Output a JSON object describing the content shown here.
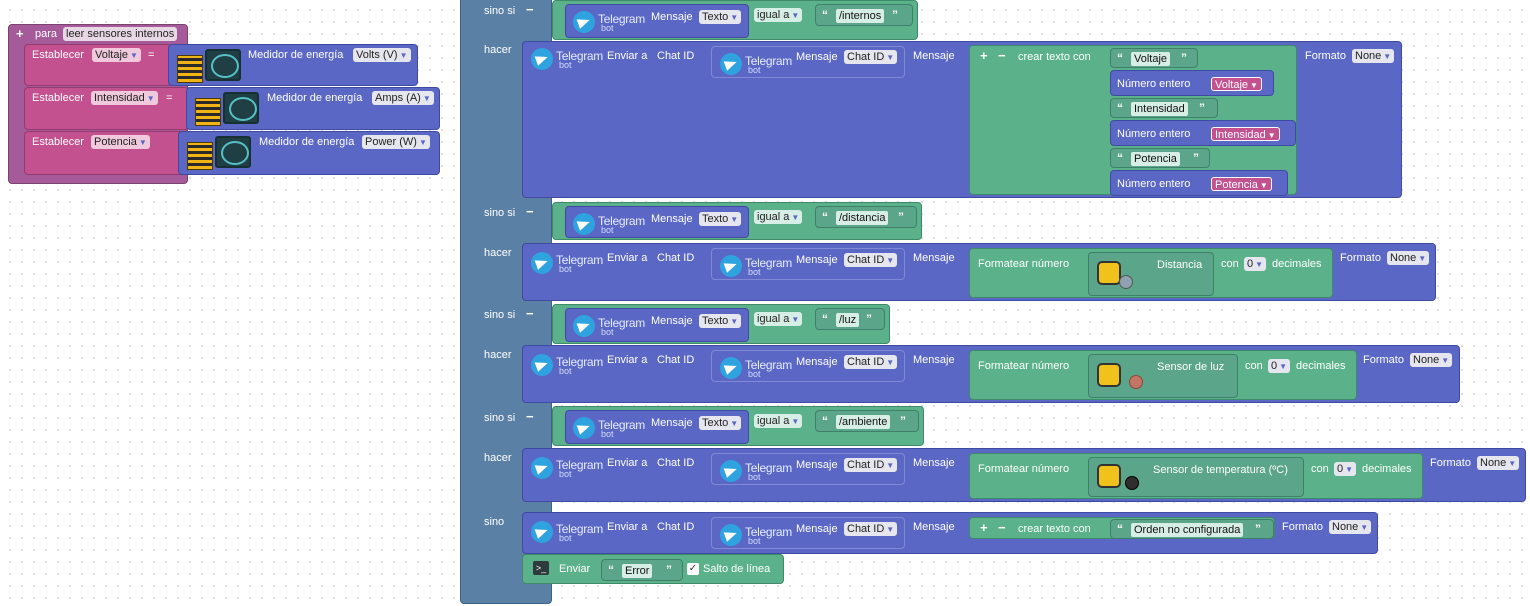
{
  "proc": {
    "plus": "+",
    "kw": "para",
    "name": "leer sensores internos",
    "rows": [
      {
        "set": "Establecer",
        "var": "Voltaje",
        "eq": "=",
        "meter": "Medidor de energía",
        "unit": "Volts (V)"
      },
      {
        "set": "Establecer",
        "var": "Intensidad",
        "eq": "=",
        "meter": "Medidor de energía",
        "unit": "Amps (A)"
      },
      {
        "set": "Establecer",
        "var": "Potencia",
        "eq": "=",
        "meter": "Medidor de energía",
        "unit": "Power (W)"
      }
    ]
  },
  "tg": {
    "brand": "Telegram",
    "sub": "bot"
  },
  "ctrl": {
    "elseif": "sino si",
    "do": "hacer",
    "else": "sino",
    "minus": "−",
    "plus": "+",
    "mensaje": "Mensaje",
    "texto": "Texto",
    "igual": "igual a",
    "enviar_a": "Enviar a",
    "chat_id": "Chat ID",
    "formato": "Formato",
    "none": "None",
    "crear": "crear texto con",
    "num_entero": "Número entero",
    "fmt_num": "Formatear número",
    "con": "con",
    "decimales": "decimales",
    "zero": "0",
    "open_q": "“",
    "close_q": "”"
  },
  "conds": [
    "/internos",
    "/distancia",
    "/luz",
    "/ambiente"
  ],
  "internos_parts": {
    "t1": "Voltaje",
    "v1": "Voltaje",
    "t2": "Intensidad",
    "v2": "Intensidad",
    "t3": "Potencia",
    "v3": "Potencia"
  },
  "sensors": {
    "dist": "Distancia",
    "luz": "Sensor de luz",
    "temp": "Sensor de temperatura (ºC)"
  },
  "else_msg": "Orden no configurada",
  "serial": {
    "enviar": "Enviar",
    "text": "Error",
    "check": "✓",
    "salto": "Salto de línea"
  }
}
